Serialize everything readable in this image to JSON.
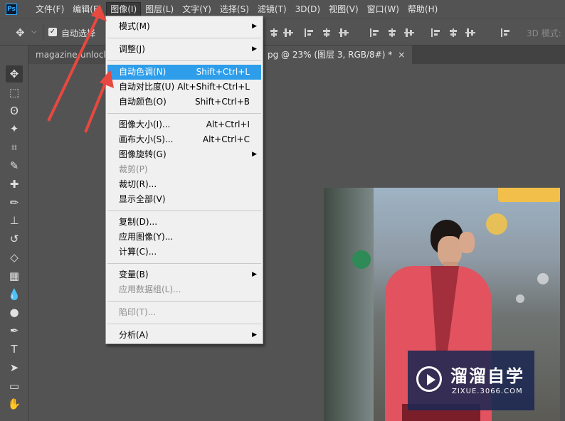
{
  "app": {
    "logo_text": "Ps"
  },
  "menubar": {
    "items": [
      "文件(F)",
      "编辑(E)",
      "图像(I)",
      "图层(L)",
      "文字(Y)",
      "选择(S)",
      "滤镜(T)",
      "3D(D)",
      "视图(V)",
      "窗口(W)",
      "帮助(H)"
    ],
    "active_index": 2
  },
  "options": {
    "auto_select_label": "自动选择",
    "auto_select_checked": true,
    "mode_3d_label": "3D 模式:"
  },
  "tabs": {
    "first": "magazine-unlock-",
    "second": "pg @ 23% (图层 3, RGB/8#) *",
    "close": "×"
  },
  "collapse_label": "»",
  "dropdown": {
    "items": [
      {
        "label": "模式(M)",
        "shortcut": "",
        "submenu": true,
        "disabled": false
      },
      {
        "sep": true
      },
      {
        "label": "调整(J)",
        "shortcut": "",
        "submenu": true,
        "disabled": false
      },
      {
        "sep": true
      },
      {
        "label": "自动色调(N)",
        "shortcut": "Shift+Ctrl+L",
        "submenu": false,
        "disabled": false,
        "highlighted": true
      },
      {
        "label": "自动对比度(U)",
        "shortcut": "Alt+Shift+Ctrl+L",
        "submenu": false,
        "disabled": false
      },
      {
        "label": "自动颜色(O)",
        "shortcut": "Shift+Ctrl+B",
        "submenu": false,
        "disabled": false
      },
      {
        "sep": true
      },
      {
        "label": "图像大小(I)...",
        "shortcut": "Alt+Ctrl+I",
        "submenu": false,
        "disabled": false
      },
      {
        "label": "画布大小(S)...",
        "shortcut": "Alt+Ctrl+C",
        "submenu": false,
        "disabled": false
      },
      {
        "label": "图像旋转(G)",
        "shortcut": "",
        "submenu": true,
        "disabled": false
      },
      {
        "label": "裁剪(P)",
        "shortcut": "",
        "submenu": false,
        "disabled": true
      },
      {
        "label": "裁切(R)...",
        "shortcut": "",
        "submenu": false,
        "disabled": false
      },
      {
        "label": "显示全部(V)",
        "shortcut": "",
        "submenu": false,
        "disabled": false
      },
      {
        "sep": true
      },
      {
        "label": "复制(D)...",
        "shortcut": "",
        "submenu": false,
        "disabled": false
      },
      {
        "label": "应用图像(Y)...",
        "shortcut": "",
        "submenu": false,
        "disabled": false
      },
      {
        "label": "计算(C)...",
        "shortcut": "",
        "submenu": false,
        "disabled": false
      },
      {
        "sep": true
      },
      {
        "label": "变量(B)",
        "shortcut": "",
        "submenu": true,
        "disabled": false
      },
      {
        "label": "应用数据组(L)...",
        "shortcut": "",
        "submenu": false,
        "disabled": true
      },
      {
        "sep": true
      },
      {
        "label": "陷印(T)...",
        "shortcut": "",
        "submenu": false,
        "disabled": true
      },
      {
        "sep": true
      },
      {
        "label": "分析(A)",
        "shortcut": "",
        "submenu": true,
        "disabled": false
      }
    ]
  },
  "tools": [
    "move-tool",
    "marquee-tool",
    "lasso-tool",
    "magic-wand-tool",
    "crop-tool",
    "eyedropper-tool",
    "healing-brush-tool",
    "brush-tool",
    "clone-stamp-tool",
    "history-brush-tool",
    "eraser-tool",
    "gradient-tool",
    "blur-tool",
    "dodge-tool",
    "pen-tool",
    "type-tool",
    "path-selection-tool",
    "rectangle-tool",
    "hand-tool"
  ],
  "tool_glyphs": [
    "✥",
    "⬚",
    "ʘ",
    "✦",
    "⌗",
    "✎",
    "✚",
    "✏",
    "⊥",
    "↺",
    "◇",
    "▦",
    "💧",
    "●",
    "✒",
    "T",
    "➤",
    "▭",
    "✋"
  ],
  "selected_tool_index": 0,
  "watermark": {
    "title": "溜溜自学",
    "url": "ZIXUE.3066.COM"
  },
  "colors": {
    "highlight": "#2e9dea",
    "annotation": "#e8483f",
    "ui_bg": "#535353"
  }
}
